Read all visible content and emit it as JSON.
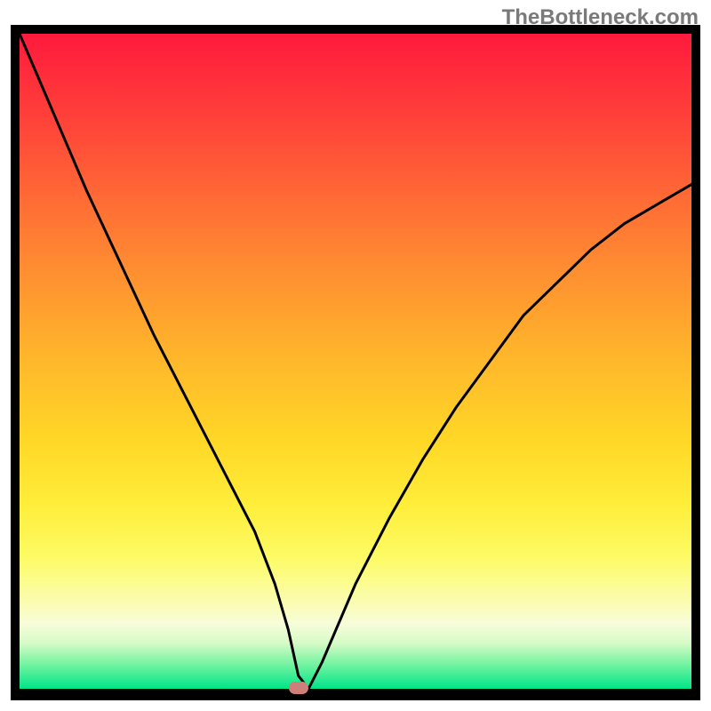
{
  "watermark": "TheBottleneck.com",
  "chart_data": {
    "type": "line",
    "title": "",
    "xlabel": "",
    "ylabel": "",
    "xlim": [
      0,
      100
    ],
    "ylim": [
      0,
      100
    ],
    "series": [
      {
        "name": "curve",
        "x": [
          0,
          5,
          10,
          15,
          20,
          25,
          30,
          35,
          38,
          40,
          41.5,
          43,
          45,
          50,
          55,
          60,
          65,
          70,
          75,
          80,
          85,
          90,
          95,
          100
        ],
        "y": [
          100,
          88,
          76,
          65,
          54,
          44,
          34,
          24,
          16,
          9,
          2,
          0,
          4,
          16,
          26,
          35,
          43,
          50,
          57,
          62,
          67,
          71,
          74,
          77
        ]
      }
    ],
    "marker": {
      "x": 41.5,
      "y": 0
    },
    "curve_min_x": 41.5,
    "background_gradient": {
      "top": "#ff1a3c",
      "mid": "#ffee3a",
      "bottom": "#00e588"
    }
  }
}
